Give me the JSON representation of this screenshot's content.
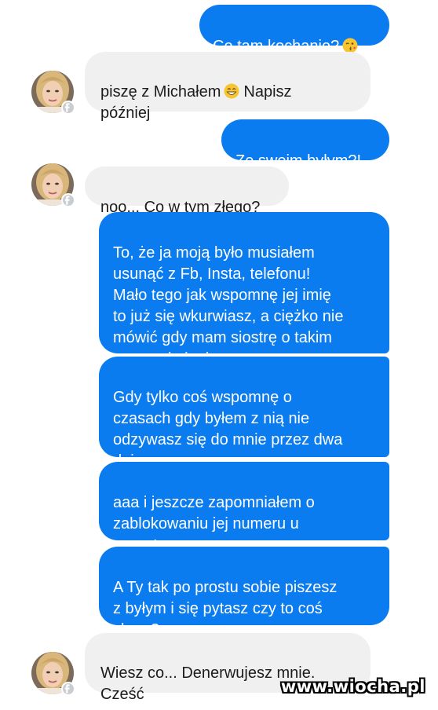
{
  "messages": [
    {
      "side": "out",
      "text": "Co tam kochanie?",
      "emoji": "kiss-wink-emoji"
    },
    {
      "side": "in",
      "text": "piszę z Michałem",
      "emoji": "grinning-emoji",
      "text_after": "Napisz\npóźniej"
    },
    {
      "side": "out",
      "text": "Ze swoim byłym?!"
    },
    {
      "side": "in",
      "text": "noo... Co w tym złego?"
    },
    {
      "side": "out",
      "text": "To, że ja moją było musiałem\nusunąć z Fb, Insta, telefonu!\nMało tego jak wspomnę jej imię\nto już się wkurwiasz, a ciężko nie\nmówić gdy mam siostrę o takim\nsamym imieniu."
    },
    {
      "side": "out",
      "text": "Gdy tylko coś wspomnę o\nczasach gdy byłem z nią nie\nodzywasz się do mnie przez dwa\ndni"
    },
    {
      "side": "out",
      "text": "aaa i jeszcze zapomniałem o\nzablokowaniu jej numeru u\noperatora"
    },
    {
      "side": "out",
      "text": "A Ty tak po prostu sobie piszesz\nz byłym i się pytasz czy to coś\nzłego?"
    },
    {
      "side": "in",
      "text": "Wiesz co... Denerwujesz mnie.\nCześć"
    }
  ],
  "watermark": "www.wiocha.pl",
  "colors": {
    "outgoing_bubble": "#0b7bf0",
    "incoming_bubble": "#f0f0f0",
    "background": "#ffffff"
  }
}
